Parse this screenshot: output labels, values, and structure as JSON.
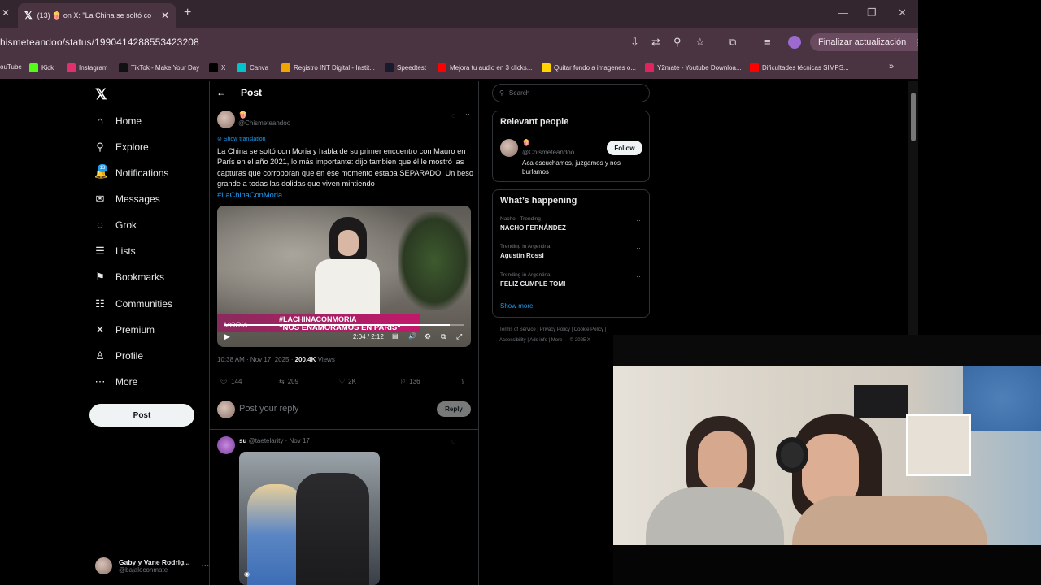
{
  "browser": {
    "tab_title": "(13) 🍿 on X: \"La China se soltó con Moria",
    "url": "hismeteandoo/status/1990414288553423208",
    "update_label": "Finalizar actualización",
    "bookmarks": [
      {
        "label": "ouTube",
        "color": "#ff0000"
      },
      {
        "label": "Kick",
        "color": "#53fc18"
      },
      {
        "label": "Instagram",
        "color": "#e1306c"
      },
      {
        "label": "TikTok - Make Your Day",
        "color": "#111111"
      },
      {
        "label": "X",
        "color": "#000000"
      },
      {
        "label": "Canva",
        "color": "#00c4cc"
      },
      {
        "label": "Registro INT Digital - Instit...",
        "color": "#f0a500"
      },
      {
        "label": "Speedtest",
        "color": "#1a1a2e"
      },
      {
        "label": "Mejora tu audio en 3 clicks...",
        "color": "#ff0000"
      },
      {
        "label": "Quitar fondo a imagenes o...",
        "color": "#ffd400"
      },
      {
        "label": "Y2mate - Youtube Downloa...",
        "color": "#e0245e"
      },
      {
        "label": "Dificultades técnicas SIMPS...",
        "color": "#ff0000"
      }
    ]
  },
  "nav": {
    "items": [
      {
        "label": "Home",
        "icon": "home-icon",
        "glyph": "⌂"
      },
      {
        "label": "Explore",
        "icon": "search-icon",
        "glyph": "⚲"
      },
      {
        "label": "Notifications",
        "icon": "bell-icon",
        "glyph": "🔔"
      },
      {
        "label": "Messages",
        "icon": "mail-icon",
        "glyph": "✉"
      },
      {
        "label": "Grok",
        "icon": "grok-icon",
        "glyph": "◌"
      },
      {
        "label": "Lists",
        "icon": "list-icon",
        "glyph": "☰"
      },
      {
        "label": "Bookmarks",
        "icon": "bookmark-icon",
        "glyph": "⚑"
      },
      {
        "label": "Communities",
        "icon": "communities-icon",
        "glyph": "☷"
      },
      {
        "label": "Premium",
        "icon": "x-icon",
        "glyph": "✕"
      },
      {
        "label": "Profile",
        "icon": "profile-icon",
        "glyph": "♙"
      },
      {
        "label": "More",
        "icon": "more-icon",
        "glyph": "⋯"
      }
    ],
    "notif_count": "13",
    "post_label": "Post",
    "account_name": "Gaby y Vane Rodrig...",
    "account_handle": "@bajaloconmate"
  },
  "post": {
    "header": "Post",
    "author_name": "🍿",
    "author_handle": "@Chismeteandoo",
    "show_translation": "Show translation",
    "text": "La China se soltó con Moria y habla de su primer encuentro con Mauro en París en el año 2021, lo más importante: dijo tambien que él le mostró las capturas que corroboran que en ese momento estaba SEPARADO! Un beso grande a todas las dolidas que viven mintiendo",
    "hashtag": "#LaChinaConMoria",
    "video_banner_1": "#LACHINACONMORIA",
    "video_banner_2": "\"NOS ENAMORAMOS EN PARIS\"",
    "video_tag": "MORIA",
    "video_time": "2:04 / 2:12",
    "video_progress": 0.94,
    "timestamp": "10:38 AM · Nov 17, 2025 · ",
    "views": "200.4K",
    "views_label": " Views",
    "replies": "144",
    "reposts": "209",
    "likes": "2K",
    "bookmarks": "136",
    "reply_placeholder": "Post your reply",
    "reply_button": "Reply"
  },
  "reply": {
    "name": "su",
    "handle": "@taetelarity · Nov 17"
  },
  "sidebar": {
    "search_placeholder": "Search",
    "relevant_title": "Relevant people",
    "person_name": "🍿",
    "person_handle": "@Chismeteandoo",
    "person_bio": "Aca escuchamos, juzgamos y nos burlamos",
    "follow_label": "Follow",
    "happening_title": "What’s happening",
    "trends": [
      {
        "meta": "Nacho · Trending",
        "name": "NACHO FERNÁNDEZ"
      },
      {
        "meta": "Trending in Argentina",
        "name": "Agustín Rossi"
      },
      {
        "meta": "Trending in Argentina",
        "name": "FELIZ CUMPLE TOMI"
      }
    ],
    "show_more": "Show more",
    "footer_1": "Terms of Service  |  Privacy Policy  |  Cookie Policy  |",
    "footer_2": "Accessibility  |  Ads info  |  More ···  © 2025 X"
  }
}
